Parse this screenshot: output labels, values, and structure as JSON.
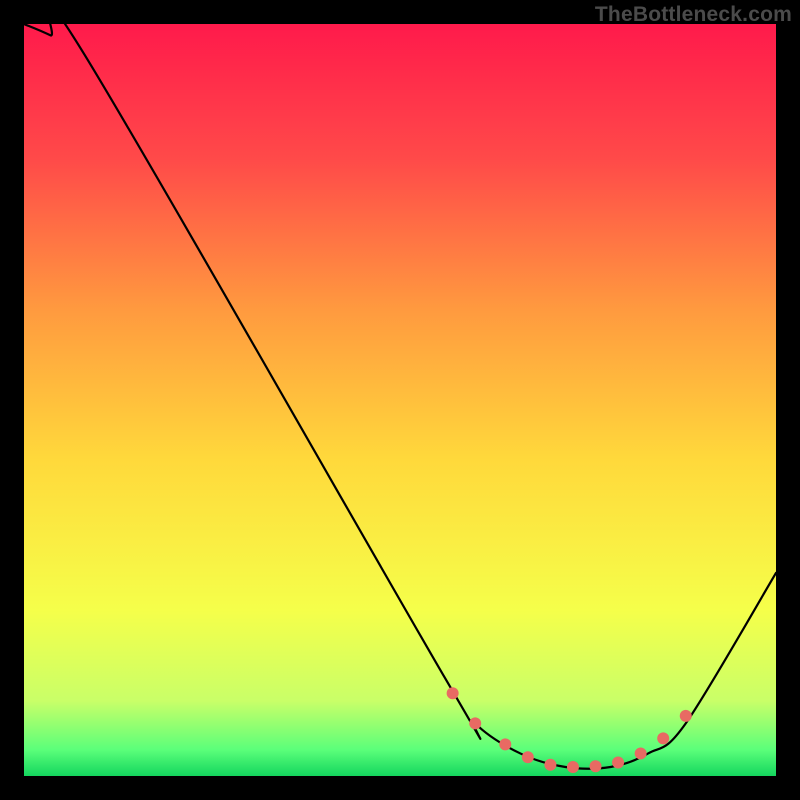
{
  "watermark": "TheBottleneck.com",
  "chart_data": {
    "type": "line",
    "title": "",
    "xlabel": "",
    "ylabel": "",
    "xlim": [
      0,
      100
    ],
    "ylim": [
      0,
      100
    ],
    "grid": false,
    "legend": false,
    "gradient_stops": [
      {
        "offset": 0.0,
        "color": "#ff1a4b"
      },
      {
        "offset": 0.18,
        "color": "#ff4a49"
      },
      {
        "offset": 0.38,
        "color": "#ff9a3f"
      },
      {
        "offset": 0.58,
        "color": "#ffd93b"
      },
      {
        "offset": 0.78,
        "color": "#f5ff4a"
      },
      {
        "offset": 0.9,
        "color": "#c9ff68"
      },
      {
        "offset": 0.965,
        "color": "#5bff7a"
      },
      {
        "offset": 1.0,
        "color": "#14d65e"
      }
    ],
    "series": [
      {
        "name": "curve",
        "color": "#000000",
        "x": [
          0,
          3.5,
          8,
          56,
          60,
          66,
          72,
          78,
          83,
          88,
          100
        ],
        "y": [
          100,
          98.5,
          96,
          13,
          7,
          3,
          1.2,
          1.2,
          3,
          7,
          27
        ]
      }
    ],
    "markers": {
      "name": "highlight-points",
      "color": "#e86a63",
      "radius": 6,
      "x": [
        57,
        60,
        64,
        67,
        70,
        73,
        76,
        79,
        82,
        85,
        88
      ],
      "y": [
        11,
        7,
        4.2,
        2.5,
        1.5,
        1.2,
        1.3,
        1.8,
        3,
        5,
        8
      ]
    }
  }
}
